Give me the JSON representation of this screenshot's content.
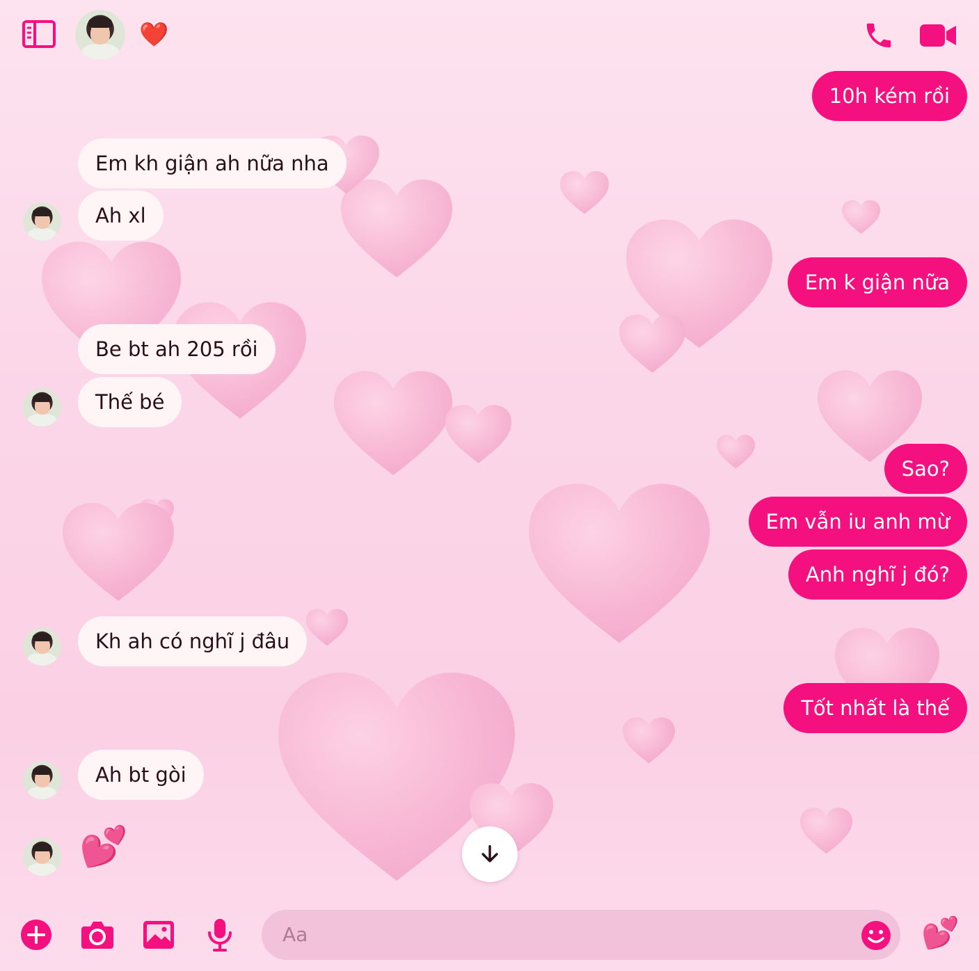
{
  "header": {
    "sidebar_icon": "sidebar-toggle-icon",
    "reaction_emoji": "❤️",
    "call_icon": "phone-icon",
    "video_icon": "video-camera-icon",
    "accent_color": "#f5107f"
  },
  "messages": [
    {
      "side": "out",
      "text": "10h kém rồi"
    },
    {
      "side": "in",
      "text": "Em kh giận ah nữa nha"
    },
    {
      "side": "in",
      "text": "Ah xl"
    },
    {
      "side": "out",
      "text": "Em k giận nữa"
    },
    {
      "side": "in",
      "text": "Be bt ah 205 rồi"
    },
    {
      "side": "in",
      "text": "Thế bé"
    },
    {
      "side": "out",
      "text": "Sao?"
    },
    {
      "side": "out",
      "text": "Em vẫn iu anh mừ"
    },
    {
      "side": "out",
      "text": "Anh nghĩ j đó?"
    },
    {
      "side": "in",
      "text": "Kh ah có nghĩ j đâu"
    },
    {
      "side": "out",
      "text": "Tốt nhất là thế"
    },
    {
      "side": "in",
      "text": "Ah bt gòi"
    },
    {
      "side": "in",
      "text": "💕"
    }
  ],
  "composer": {
    "placeholder": "Aa",
    "add_icon": "plus-circle-icon",
    "camera_icon": "camera-icon",
    "gallery_icon": "image-icon",
    "mic_icon": "microphone-icon",
    "emoji_icon": "smiley-icon",
    "quick_reaction": "💕"
  },
  "scroll_down_icon": "arrow-down-icon"
}
